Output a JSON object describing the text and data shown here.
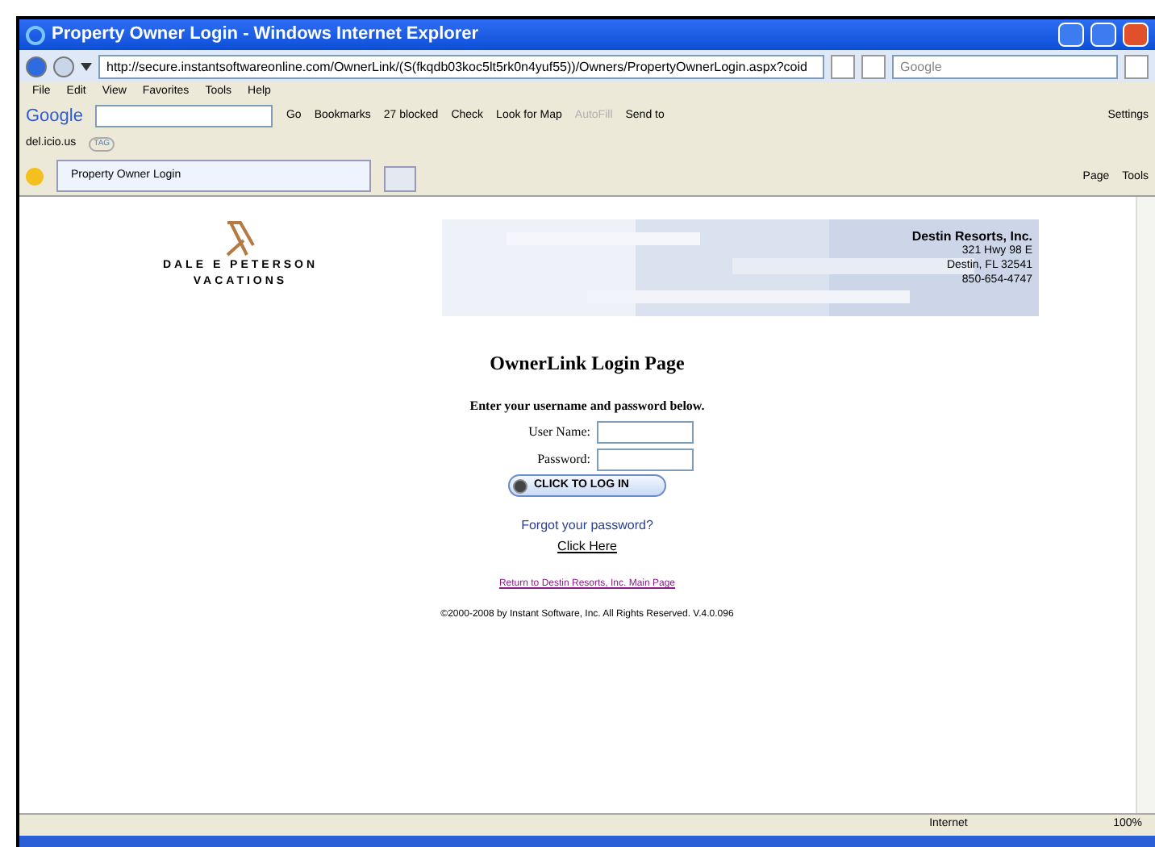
{
  "window": {
    "title": "Property Owner Login - Windows Internet Explorer"
  },
  "address_bar": {
    "url": "http://secure.instantsoftwareonline.com/OwnerLink/(S(fkqdb03koc5lt5rk0n4yuf55))/Owners/PropertyOwnerLogin.aspx?coid",
    "search_placeholder": "Google"
  },
  "menu": [
    "File",
    "Edit",
    "View",
    "Favorites",
    "Tools",
    "Help"
  ],
  "google_toolbar": {
    "logo": "Google",
    "go": "Go",
    "items": [
      {
        "label": "Bookmarks",
        "disabled": false
      },
      {
        "label": "27 blocked",
        "disabled": false
      },
      {
        "label": "Check",
        "disabled": false
      },
      {
        "label": "Look for Map",
        "disabled": false
      },
      {
        "label": "AutoFill",
        "disabled": true
      },
      {
        "label": "Send to",
        "disabled": false
      }
    ],
    "settings": "Settings"
  },
  "delicious_bar": {
    "label": "del.icio.us",
    "tag": "TAG"
  },
  "tabs": [
    {
      "label": "Property Owner Login",
      "selected": true
    }
  ],
  "command_bar": [
    "Page",
    "Tools"
  ],
  "page": {
    "brand": [
      "DALE E PETERSON",
      "VACATIONS"
    ],
    "company": {
      "name": "Destin Resorts, Inc.",
      "lines": [
        "321 Hwy 98 E",
        "Destin, FL 32541",
        "850-654-4747"
      ]
    },
    "heading": "OwnerLink Login Page",
    "instructions": "Enter your username and password below.",
    "fields": [
      {
        "label": "User Name:"
      },
      {
        "label": "Password:"
      }
    ],
    "login_button": "CLICK TO LOG IN",
    "forgot": "Forgot your password?",
    "click_here": "Click Here",
    "return_link": "Return to Destin Resorts, Inc. Main Page",
    "copyright": "©2000-2008 by Instant Software, Inc. All Rights Reserved. V.4.0.096"
  },
  "status_bar": {
    "zone": "Internet",
    "zoom": "100%"
  }
}
